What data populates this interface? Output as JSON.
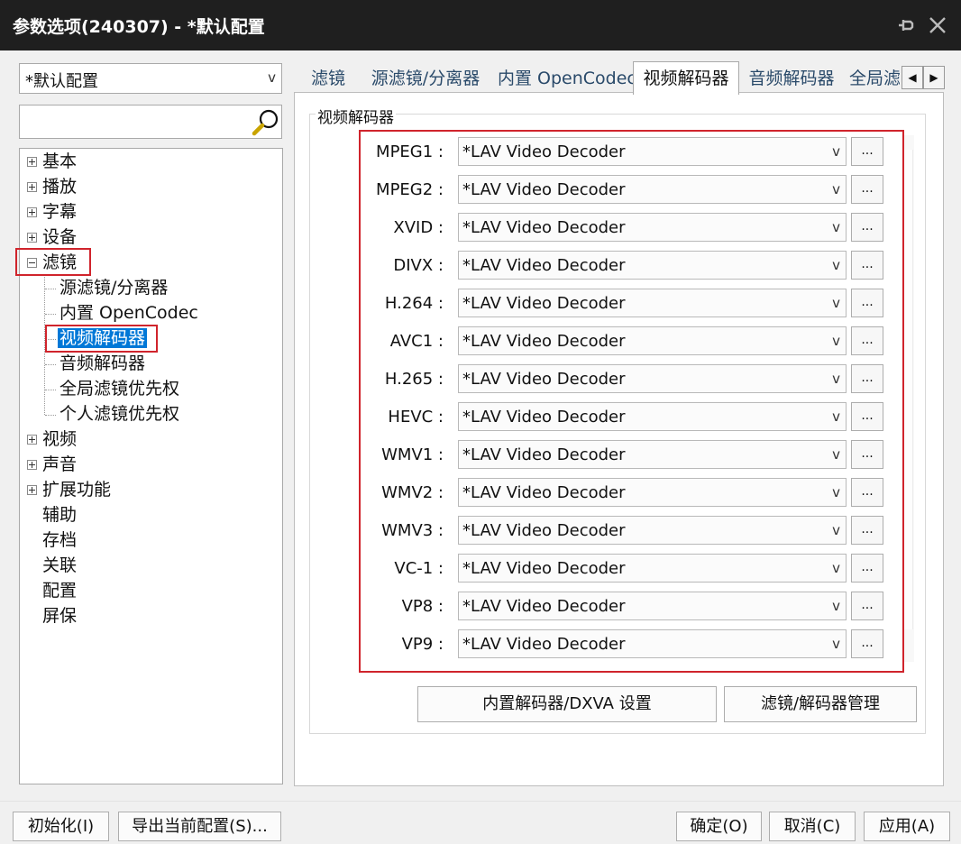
{
  "window": {
    "title": "参数选项(240307) - *默认配置"
  },
  "profile_select": {
    "value": "*默认配置"
  },
  "search": {
    "placeholder": ""
  },
  "tree": {
    "items": [
      {
        "label": "基本"
      },
      {
        "label": "播放"
      },
      {
        "label": "字幕"
      },
      {
        "label": "设备"
      },
      {
        "label": "滤镜"
      },
      {
        "label": "源滤镜/分离器"
      },
      {
        "label": "内置 OpenCodec"
      },
      {
        "label": "视频解码器"
      },
      {
        "label": "音频解码器"
      },
      {
        "label": "全局滤镜优先权"
      },
      {
        "label": "个人滤镜优先权"
      },
      {
        "label": "视频"
      },
      {
        "label": "声音"
      },
      {
        "label": "扩展功能"
      },
      {
        "label": "辅助"
      },
      {
        "label": "存档"
      },
      {
        "label": "关联"
      },
      {
        "label": "配置"
      },
      {
        "label": "屏保"
      }
    ]
  },
  "tabs": [
    {
      "label": "滤镜"
    },
    {
      "label": "源滤镜/分离器"
    },
    {
      "label": "内置 OpenCodec"
    },
    {
      "label": "视频解码器"
    },
    {
      "label": "音频解码器"
    },
    {
      "label": "全局滤"
    }
  ],
  "tab_scroll": {
    "left": "◀",
    "right": "▶"
  },
  "group": {
    "title": "视频解码器"
  },
  "decoders": [
    {
      "label": "MPEG1 :",
      "value": "*LAV Video Decoder"
    },
    {
      "label": "MPEG2 :",
      "value": "*LAV Video Decoder"
    },
    {
      "label": "XVID :",
      "value": "*LAV Video Decoder"
    },
    {
      "label": "DIVX :",
      "value": "*LAV Video Decoder"
    },
    {
      "label": "H.264 :",
      "value": "*LAV Video Decoder"
    },
    {
      "label": "AVC1 :",
      "value": "*LAV Video Decoder"
    },
    {
      "label": "H.265 :",
      "value": "*LAV Video Decoder"
    },
    {
      "label": "HEVC :",
      "value": "*LAV Video Decoder"
    },
    {
      "label": "WMV1 :",
      "value": "*LAV Video Decoder"
    },
    {
      "label": "WMV2 :",
      "value": "*LAV Video Decoder"
    },
    {
      "label": "WMV3 :",
      "value": "*LAV Video Decoder"
    },
    {
      "label": "VC-1 :",
      "value": "*LAV Video Decoder"
    },
    {
      "label": "VP8 :",
      "value": "*LAV Video Decoder"
    },
    {
      "label": "VP9 :",
      "value": "*LAV Video Decoder"
    }
  ],
  "decoder_more_label": "...",
  "buttons": {
    "dxva": "内置解码器/DXVA 设置",
    "filter_manager": "滤镜/解码器管理",
    "initialize": "初始化(I)",
    "export": "导出当前配置(S)...",
    "ok": "确定(O)",
    "cancel": "取消(C)",
    "apply": "应用(A)"
  },
  "colors": {
    "highlight_red": "#d0242c",
    "selection_blue": "#0078d7",
    "titlebar": "#1f1f1f"
  }
}
